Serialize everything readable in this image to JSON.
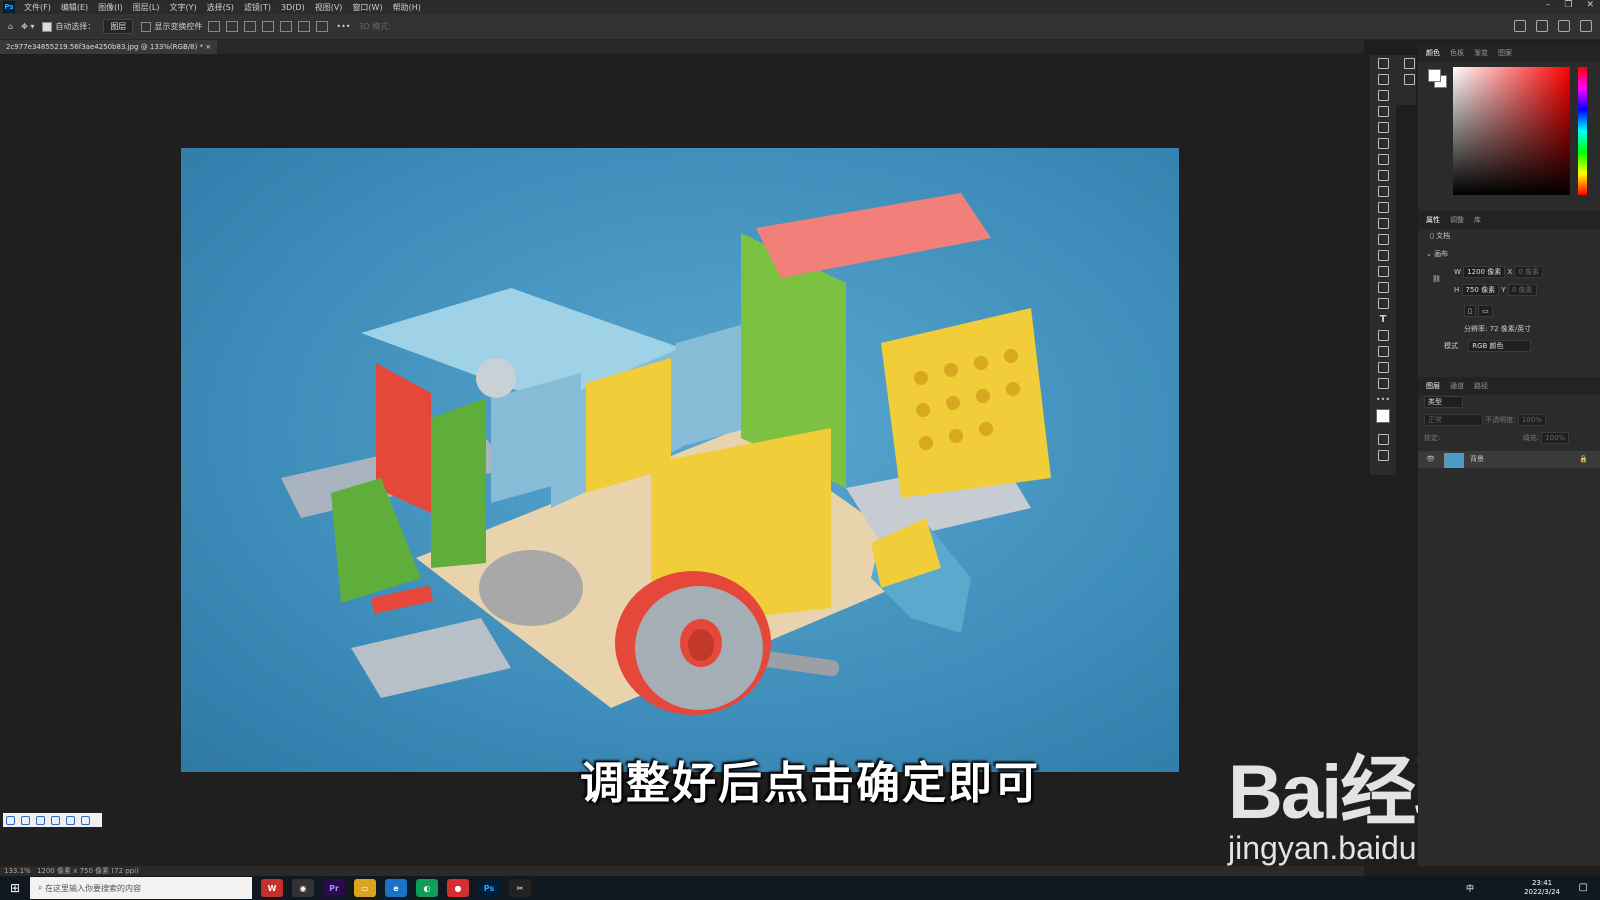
{
  "app": {
    "logo": "Ps"
  },
  "menu": [
    "文件(F)",
    "编辑(E)",
    "图像(I)",
    "图层(L)",
    "文字(Y)",
    "选择(S)",
    "滤镜(T)",
    "3D(D)",
    "视图(V)",
    "窗口(W)",
    "帮助(H)"
  ],
  "options_bar": {
    "auto_select_label": "自动选择：",
    "auto_select_value": "图层",
    "show_transform_label": "显示变换控件",
    "mode_3d_label": "3D 模式:"
  },
  "document": {
    "tab_title": "2c977e34855219.56f3ae4250b83.jpg @ 133%(RGB/8) *",
    "zoom": "133.1%",
    "info": "1200 像素 x 750 像素 (72 ppi)"
  },
  "subtitle": "调整好后点击确定即可",
  "watermark": {
    "brand": "Bai经验",
    "url": "jingyan.baidu.com"
  },
  "color_panel": {
    "tabs": [
      "颜色",
      "色板",
      "渐变",
      "图案"
    ]
  },
  "properties_panel": {
    "tabs": [
      "属性",
      "调整",
      "库"
    ],
    "doc_label": "文档",
    "section": "画布",
    "w_label": "W",
    "w_value": "1200 像素",
    "h_label": "H",
    "h_value": "750 像素",
    "x_label": "X",
    "x_value": "0 像素",
    "y_label": "Y",
    "y_value": "0 像素",
    "resolution": "分辨率: 72 像素/英寸",
    "mode_label": "模式",
    "mode_value": "RGB 颜色"
  },
  "layers_panel": {
    "tabs": [
      "图层",
      "通道",
      "路径"
    ],
    "filter_placeholder": "类型",
    "blend_mode": "正常",
    "opacity_label": "不透明度:",
    "opacity_value": "100%",
    "lock_label": "锁定:",
    "fill_label": "填充:",
    "fill_value": "100%",
    "layer_name": "背景"
  },
  "taskbar": {
    "search_placeholder": "在这里输入你要搜索的内容",
    "time": "23:41",
    "date": "2022/3/24",
    "ime": "中"
  },
  "colors": {
    "artwork_bg": "#4a9bc8",
    "accent_blue": "#31a8ff"
  }
}
